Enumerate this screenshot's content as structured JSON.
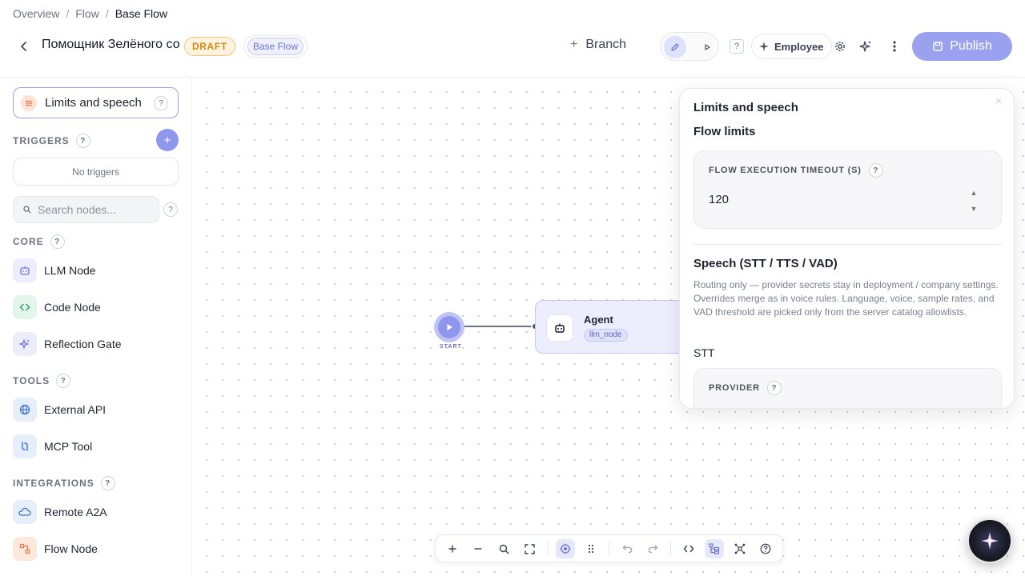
{
  "breadcrumb": {
    "items": [
      "Overview",
      "Flow"
    ],
    "current": "Base Flow"
  },
  "header": {
    "flow_title": "Помощник Зелёного со",
    "draft_badge": "DRAFT",
    "base_flow_badge": "Base Flow",
    "branch_label": "Branch",
    "help": "?",
    "employee_label": "Employee",
    "publish_label": "Publish"
  },
  "sidebar": {
    "limits_button": "Limits and speech",
    "help": "?",
    "triggers_label": "TRIGGERS",
    "add_trigger": "+",
    "no_triggers": "No triggers",
    "search_placeholder": "Search nodes...",
    "sections": {
      "core": {
        "label": "CORE",
        "items": [
          "LLM Node",
          "Code Node",
          "Reflection Gate"
        ]
      },
      "tools": {
        "label": "TOOLS",
        "items": [
          "External API",
          "MCP Tool"
        ]
      },
      "integrations": {
        "label": "INTEGRATIONS",
        "items": [
          "Remote A2A",
          "Flow Node"
        ]
      }
    }
  },
  "canvas": {
    "start_label": "START",
    "agent_node": {
      "title": "Agent",
      "tag": "llm_node"
    }
  },
  "panel": {
    "title": "Limits and speech",
    "flow_limits_heading": "Flow limits",
    "timeout_label": "FLOW EXECUTION TIMEOUT (S)",
    "timeout_value": "120",
    "speech_heading": "Speech (STT / TTS / VAD)",
    "speech_description": "Routing only — provider secrets stay in deployment / company settings. Overrides merge as in voice rules. Language, voice, sample rates, and VAD threshold are picked only from the server catalog allowlists.",
    "stt_label": "STT",
    "provider_label": "PROVIDER",
    "help": "?"
  },
  "colors": {
    "accent": "#8f97ec",
    "accent_light": "#e6e8fc",
    "draft": "#d28a10",
    "publish_bg": "#9aa2f0"
  }
}
